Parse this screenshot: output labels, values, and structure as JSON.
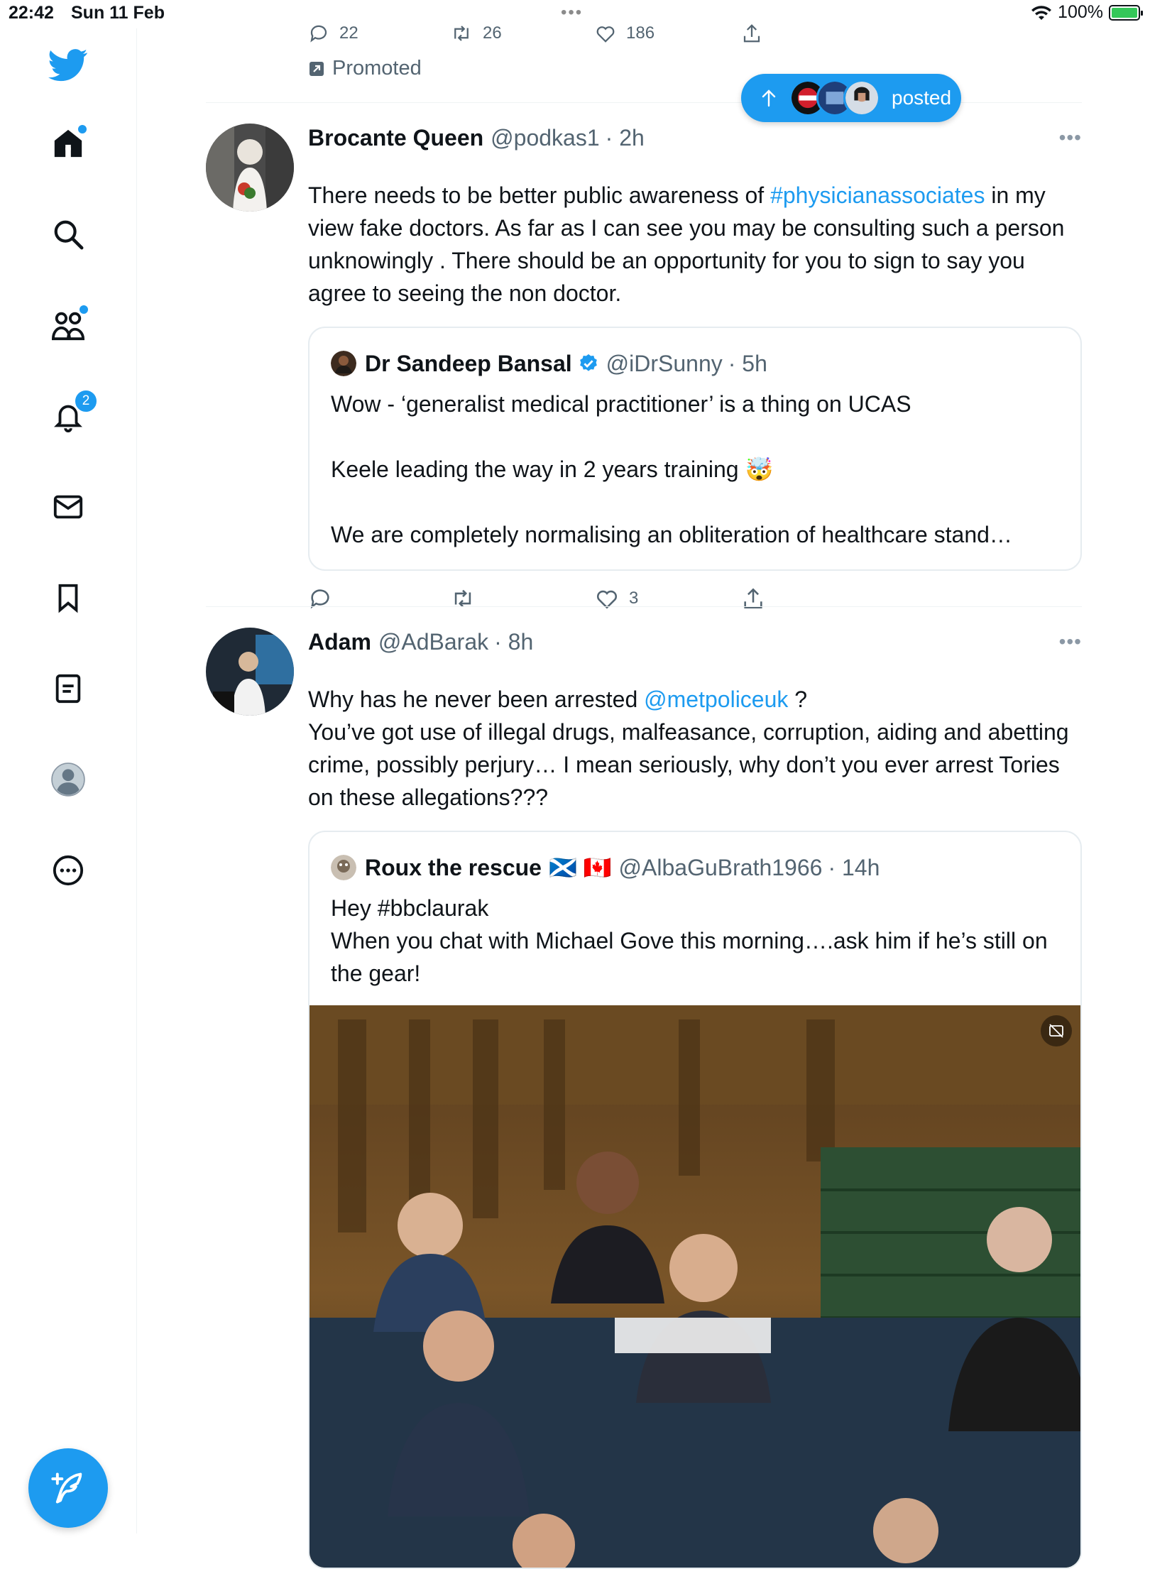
{
  "status_bar": {
    "time": "22:42",
    "date": "Sun 11 Feb",
    "dots": "•••",
    "battery": "100%"
  },
  "sidebar": {
    "notification_count": "2"
  },
  "top_tweet": {
    "reply_count": "22",
    "retweet_count": "26",
    "like_count": "186",
    "promoted_label": "Promoted"
  },
  "new_posts_pill": {
    "label": "posted"
  },
  "tweets": [
    {
      "name": "Brocante Queen",
      "handle": "@podkas1",
      "time": "· 2h",
      "text_1": "There needs to be better public awareness of ",
      "hashtag": "#physicianassociates",
      "text_2": " in my view fake doctors. As far as I can see you may be consulting such a person unknowingly . There should be an opportunity for you to sign to say you agree to seeing the non doctor.",
      "quote": {
        "name": "Dr Sandeep Bansal",
        "handle": "@iDrSunny",
        "time": "· 5h",
        "text": "Wow - ‘generalist medical practitioner’ is a thing on UCAS\n\nKeele leading the way in 2 years training 🤯\n\nWe are completely normalising an obliteration of healthcare stand…"
      },
      "like_count": "3"
    },
    {
      "name": "Adam",
      "handle": "@AdBarak",
      "time": "· 8h",
      "text_1": "Why has he never been arrested ",
      "mention": "@metpoliceuk",
      "text_2": " ?\nYou’ve got use of illegal drugs, malfeasance, corruption, aiding and abetting crime, possibly perjury… I mean seriously, why don’t you ever arrest Tories on these allegations???",
      "quote": {
        "name": "Roux the rescue",
        "flags": "🏴󠁧󠁢󠁳󠁣󠁴󠁿 🇨🇦",
        "handle": "@AlbaGuBrath1966",
        "time": "· 14h",
        "text": "Hey #bbclaurak\nWhen you chat with Michael Gove this morning….ask him if he’s still on the gear!"
      }
    }
  ],
  "colors": {
    "accent": "#1d9bf0",
    "text": "#0f1419",
    "secondary": "#536471",
    "border": "#eff3f4"
  }
}
